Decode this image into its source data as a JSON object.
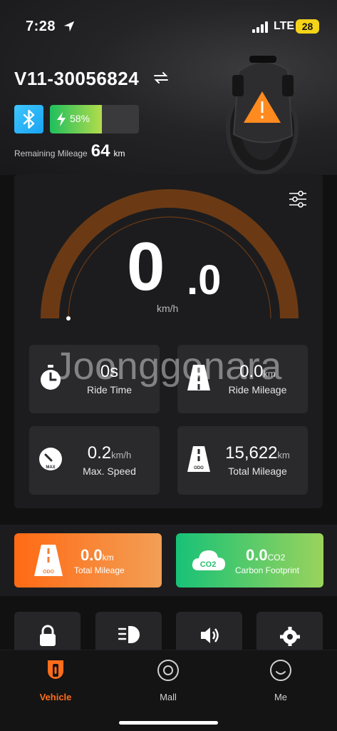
{
  "status_bar": {
    "time": "7:28",
    "network": "LTE",
    "battery": "28"
  },
  "header": {
    "device_name": "V11-30056824",
    "battery_percent": "58%",
    "battery_level": 0.58,
    "remaining_label": "Remaining Mileage",
    "remaining_value": "64",
    "remaining_unit": "km"
  },
  "speedometer": {
    "integer": "0",
    "decimal": ".0",
    "unit": "km/h",
    "level": 0
  },
  "stats": {
    "ride_time": {
      "value": "0s",
      "unit": "",
      "label": "Ride Time",
      "icon": "stopwatch-icon"
    },
    "ride_mileage": {
      "value": "0.0",
      "unit": "km",
      "label": "Ride Mileage",
      "icon": "road-icon"
    },
    "max_speed": {
      "value": "0.2",
      "unit": "km/h",
      "label": "Max. Speed",
      "icon": "max-gauge-icon",
      "badge": "MAX"
    },
    "total_mileage": {
      "value": "15,622",
      "unit": "km",
      "label": "Total Mileage",
      "icon": "odo-road-icon",
      "badge": "ODO"
    }
  },
  "watermark": "Joonggonara",
  "summary": {
    "total_mileage": {
      "value": "0.0",
      "unit": "km",
      "label": "Total Mileage",
      "badge": "ODO"
    },
    "carbon": {
      "value": "0.0",
      "unit": "CO2",
      "label": "Carbon Footprint",
      "badge": "CO2"
    }
  },
  "controls": [
    "lock-icon",
    "headlight-icon",
    "speaker-icon",
    "settings-gear-icon"
  ],
  "tabs": [
    {
      "label": "Vehicle",
      "icon": "vehicle-icon",
      "active": true
    },
    {
      "label": "Mall",
      "icon": "mall-icon",
      "active": false
    },
    {
      "label": "Me",
      "icon": "me-icon",
      "active": false
    }
  ],
  "colors": {
    "accent": "#ff6d1a",
    "gauge_arc": "#6b3a14",
    "battery_green": "#1fbf5e",
    "bluetooth": "#2bb5f8"
  }
}
